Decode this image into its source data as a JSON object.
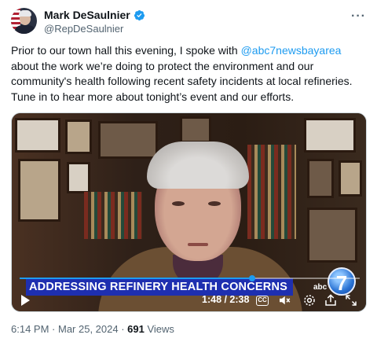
{
  "author": {
    "display_name": "Mark DeSaulnier",
    "handle": "@RepDeSaulnier",
    "verified": true,
    "verified_color": "#1d9bf0"
  },
  "menu": {
    "more_label": "···"
  },
  "tweet": {
    "text_before": "Prior to our town hall this evening, I spoke with ",
    "mention": "@abc7newsbayarea",
    "text_after": " about the work we’re doing to protect the environment and our community's health following recent safety incidents at local refineries. Tune in to hear more about tonight’s event and our efforts."
  },
  "video": {
    "lower_third": "ADDRESSING REFINERY HEALTH CONCERNS",
    "channel_logo": "7",
    "channel_word": "abc",
    "current_time": "1:48",
    "duration": "2:38",
    "time_display": "1:48 / 2:38",
    "progress_fraction": 0.684,
    "controls": {
      "play_icon": "play-icon",
      "cc_label": "CC",
      "volume_icon": "volume-icon",
      "settings_icon": "settings-icon",
      "share_icon": "share-icon",
      "fullscreen_icon": "fullscreen-icon"
    }
  },
  "meta": {
    "time": "6:14 PM",
    "separator": " · ",
    "date": "Mar 25, 2024",
    "views_count": "691",
    "views_label": " Views"
  },
  "colors": {
    "accent": "#1d9bf0",
    "text": "#0f1419",
    "muted": "#536471",
    "lower_third_bg": "#1e2fb0"
  }
}
